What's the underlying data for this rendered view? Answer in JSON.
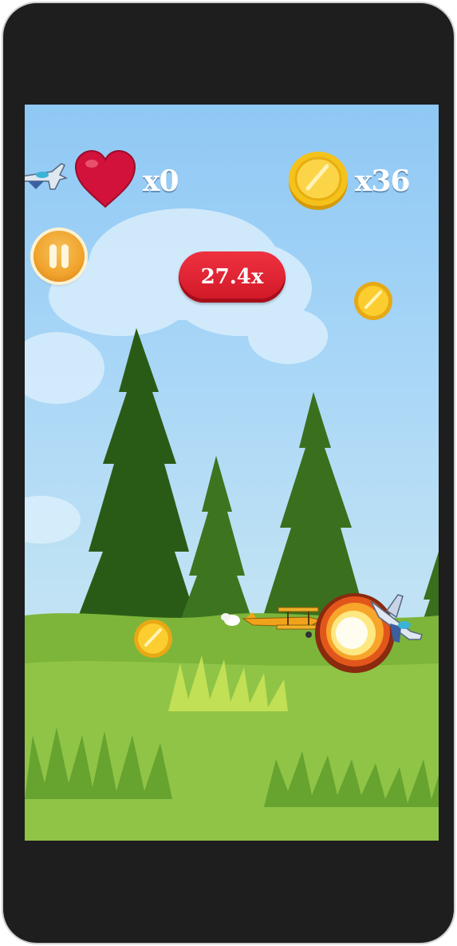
{
  "hud": {
    "lives_label": "x0",
    "coins_label": "x36",
    "multiplier_label": "27.4x"
  },
  "icons": {
    "lives": "heart-icon",
    "coins": "coin-icon",
    "pause": "pause-icon"
  },
  "colors": {
    "sky": "#a8d6f7",
    "grass": "#7cb53a",
    "multiplier_badge": "#e02030",
    "heart": "#d2123b",
    "coin": "#f5c21b",
    "pause_button": "#f1a32c"
  }
}
